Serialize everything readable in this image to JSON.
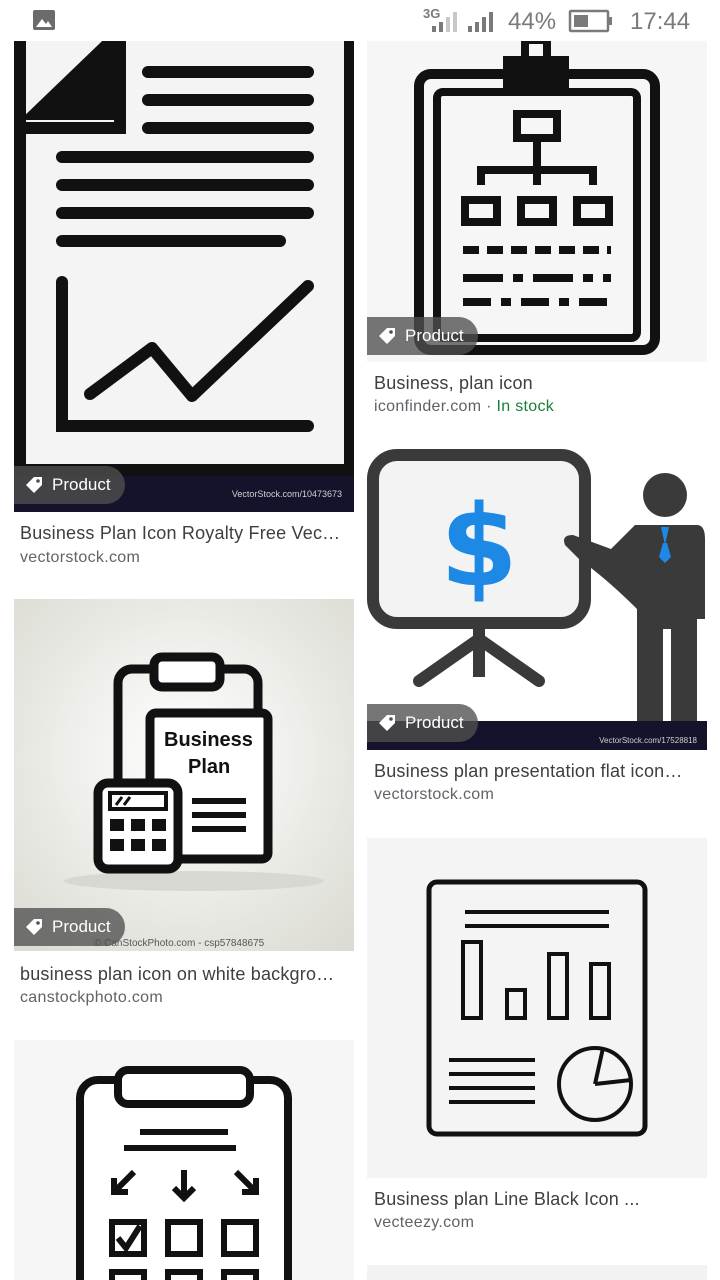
{
  "status_bar": {
    "network": "3G",
    "battery": "44%",
    "time": "17:44"
  },
  "chip_label": "Product",
  "results": [
    {
      "title": "Business Plan Icon Royalty Free Vec…",
      "source": "vectorstock.com",
      "watermark": "VectorStock.com/10473673"
    },
    {
      "title": "Business, plan icon",
      "source": "iconfinder.com",
      "separator": "·",
      "availability": "In stock"
    },
    {
      "title": "business plan icon on white backgro…",
      "source": "canstockphoto.com",
      "watermark": "© CanStockPhoto.com - csp57848675",
      "image_text": [
        "Business",
        "Plan"
      ]
    },
    {
      "title": "Business plan presentation flat icon…",
      "source": "vectorstock.com",
      "watermark": "VectorStock.com/17528818"
    },
    {
      "title": "Business plan Line Black Icon ...",
      "source": "vecteezy.com"
    }
  ],
  "colors": {
    "chip_bg": "#505050",
    "title": "#3c4043",
    "source": "#5f6368",
    "in_stock": "#188038",
    "dollar_blue": "#1e88e5"
  }
}
